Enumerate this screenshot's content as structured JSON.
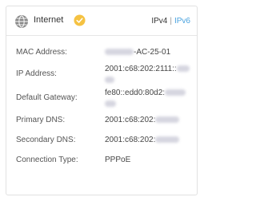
{
  "header": {
    "title": "Internet",
    "ipv4_label": "IPv4",
    "separator": "|",
    "ipv6_label": "IPv6",
    "active_color": "#4aa3df",
    "status_icon": "check-circle-icon",
    "status_color": "#f5c242"
  },
  "rows": [
    {
      "label": "MAC Address:",
      "value": "-AC-25-01"
    },
    {
      "label": "IP Address:",
      "value": "2001:c68:202:2111::"
    },
    {
      "label": "Default Gateway:",
      "value": "fe80::edd0:80d2:"
    },
    {
      "label": "Primary DNS:",
      "value": "2001:c68:202:"
    },
    {
      "label": "Secondary DNS:",
      "value": "2001:c68:202:"
    },
    {
      "label": "Connection Type:",
      "value": "PPPoE"
    }
  ]
}
